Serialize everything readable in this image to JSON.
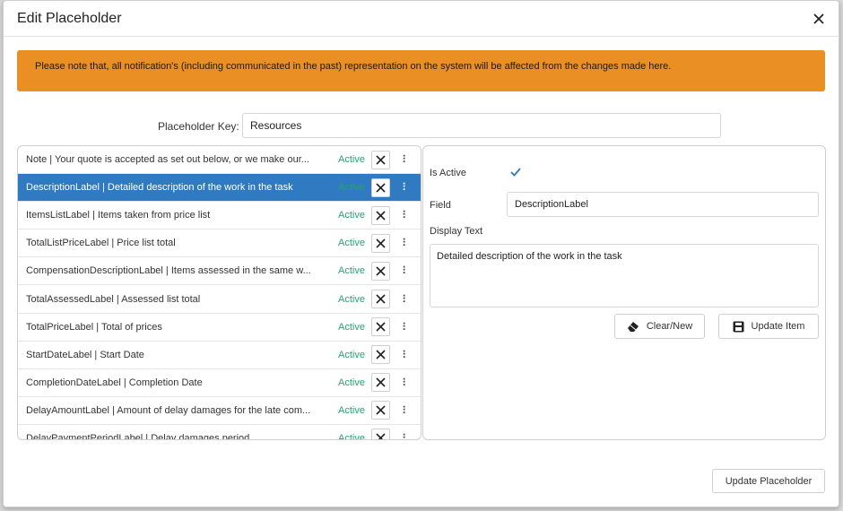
{
  "modal": {
    "title": "Edit Placeholder",
    "notice": "Please note that, all notification's (including communicated in the past) representation on the system will be affected from the changes made here."
  },
  "placeholder_key": {
    "label": "Placeholder Key:",
    "value": "Resources"
  },
  "items": [
    {
      "text": "Note | Your quote is accepted as set out below, or we make our...",
      "status": "Active",
      "selected": false
    },
    {
      "text": "DescriptionLabel | Detailed description of the work in the task",
      "status": "Active",
      "selected": true
    },
    {
      "text": "ItemsListLabel | Items taken from price list",
      "status": "Active",
      "selected": false
    },
    {
      "text": "TotalListPriceLabel | Price list total",
      "status": "Active",
      "selected": false
    },
    {
      "text": "CompensationDescriptionLabel | Items assessed in the same w...",
      "status": "Active",
      "selected": false
    },
    {
      "text": "TotalAssessedLabel | Assessed list total",
      "status": "Active",
      "selected": false
    },
    {
      "text": "TotalPriceLabel | Total of prices",
      "status": "Active",
      "selected": false
    },
    {
      "text": "StartDateLabel | Start Date",
      "status": "Active",
      "selected": false
    },
    {
      "text": "CompletionDateLabel | Completion Date",
      "status": "Active",
      "selected": false
    },
    {
      "text": "DelayAmountLabel | Amount of delay damages for the late com...",
      "status": "Active",
      "selected": false
    },
    {
      "text": "DelayPaymentPeriodLabel | Delay damages period",
      "status": "Active",
      "selected": false
    }
  ],
  "detail": {
    "is_active_label": "Is Active",
    "is_active": true,
    "field_label": "Field",
    "field_value": "DescriptionLabel",
    "display_text_label": "Display Text",
    "display_text_value": "Detailed description of the work in the task",
    "clear_button": "Clear/New",
    "update_item_button": "Update Item"
  },
  "footer": {
    "update_placeholder_button": "Update Placeholder"
  },
  "colors": {
    "notice_bg": "#ea8f23",
    "selected_row": "#2f7ac0",
    "active_status": "#27a36f",
    "check": "#2f7ac0"
  },
  "icons": {
    "close": "close-icon",
    "remove": "x-icon",
    "drag": "drag-handle-icon",
    "check": "check-icon",
    "eraser": "eraser-icon",
    "save": "save-icon"
  }
}
